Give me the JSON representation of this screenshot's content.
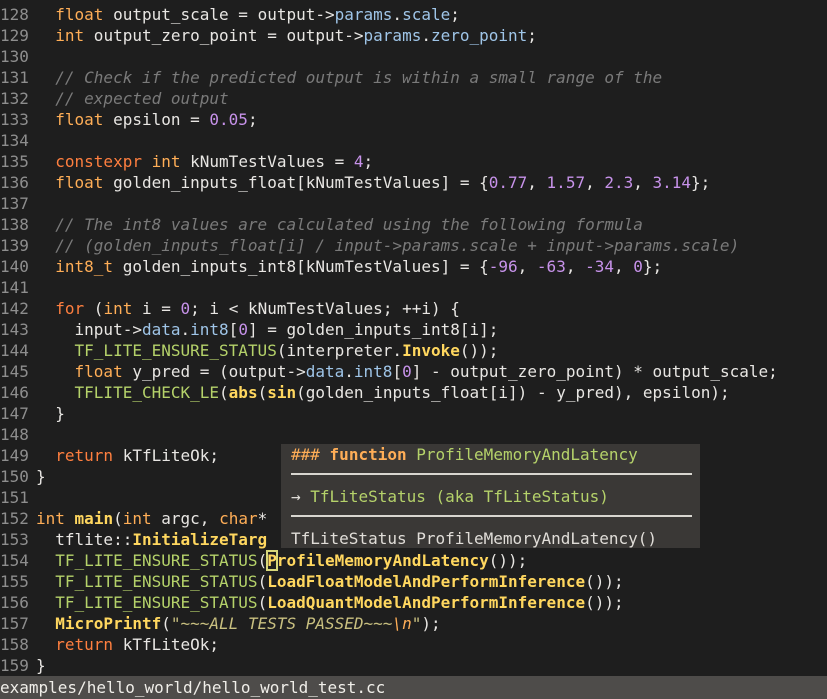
{
  "editor": {
    "lines": [
      {
        "n": "128",
        "t": [
          [
            "plain",
            "  "
          ],
          [
            "ty",
            "float"
          ],
          [
            "plain",
            " output_scale = output->"
          ],
          [
            "mem",
            "params"
          ],
          [
            "plain",
            "."
          ],
          [
            "mem",
            "scale"
          ],
          [
            "plain",
            ";"
          ]
        ]
      },
      {
        "n": "129",
        "t": [
          [
            "plain",
            "  "
          ],
          [
            "ty",
            "int"
          ],
          [
            "plain",
            " output_zero_point = output->"
          ],
          [
            "mem",
            "params"
          ],
          [
            "plain",
            "."
          ],
          [
            "mem",
            "zero_point"
          ],
          [
            "plain",
            ";"
          ]
        ]
      },
      {
        "n": "130",
        "t": []
      },
      {
        "n": "131",
        "t": [
          [
            "plain",
            "  "
          ],
          [
            "cmt",
            "// Check if the predicted output is within a small range of the"
          ]
        ]
      },
      {
        "n": "132",
        "t": [
          [
            "plain",
            "  "
          ],
          [
            "cmt",
            "// expected output"
          ]
        ]
      },
      {
        "n": "133",
        "t": [
          [
            "plain",
            "  "
          ],
          [
            "ty",
            "float"
          ],
          [
            "plain",
            " epsilon = "
          ],
          [
            "num",
            "0.05"
          ],
          [
            "plain",
            ";"
          ]
        ]
      },
      {
        "n": "134",
        "t": []
      },
      {
        "n": "135",
        "t": [
          [
            "plain",
            "  "
          ],
          [
            "kw",
            "constexpr"
          ],
          [
            "plain",
            " "
          ],
          [
            "ty",
            "int"
          ],
          [
            "plain",
            " kNumTestValues = "
          ],
          [
            "num",
            "4"
          ],
          [
            "plain",
            ";"
          ]
        ]
      },
      {
        "n": "136",
        "t": [
          [
            "plain",
            "  "
          ],
          [
            "ty",
            "float"
          ],
          [
            "plain",
            " golden_inputs_float[kNumTestValues] = {"
          ],
          [
            "num",
            "0.77"
          ],
          [
            "plain",
            ", "
          ],
          [
            "num",
            "1.57"
          ],
          [
            "plain",
            ", "
          ],
          [
            "num",
            "2.3"
          ],
          [
            "plain",
            ", "
          ],
          [
            "num",
            "3.14"
          ],
          [
            "plain",
            "};"
          ]
        ]
      },
      {
        "n": "137",
        "t": []
      },
      {
        "n": "138",
        "t": [
          [
            "plain",
            "  "
          ],
          [
            "cmt",
            "// The int8 values are calculated using the following formula"
          ]
        ]
      },
      {
        "n": "139",
        "t": [
          [
            "plain",
            "  "
          ],
          [
            "cmt",
            "// (golden_inputs_float[i] / input->params.scale + input->params.scale)"
          ]
        ]
      },
      {
        "n": "140",
        "t": [
          [
            "plain",
            "  "
          ],
          [
            "ty",
            "int8_t"
          ],
          [
            "plain",
            " golden_inputs_int8[kNumTestValues] = {"
          ],
          [
            "num",
            "-96"
          ],
          [
            "plain",
            ", "
          ],
          [
            "num",
            "-63"
          ],
          [
            "plain",
            ", "
          ],
          [
            "num",
            "-34"
          ],
          [
            "plain",
            ", "
          ],
          [
            "num",
            "0"
          ],
          [
            "plain",
            "};"
          ]
        ]
      },
      {
        "n": "141",
        "t": []
      },
      {
        "n": "142",
        "t": [
          [
            "plain",
            "  "
          ],
          [
            "kw",
            "for"
          ],
          [
            "plain",
            " ("
          ],
          [
            "ty",
            "int"
          ],
          [
            "plain",
            " i = "
          ],
          [
            "num",
            "0"
          ],
          [
            "plain",
            "; i < kNumTestValues; ++i) {"
          ]
        ]
      },
      {
        "n": "143",
        "t": [
          [
            "plain",
            "    input->"
          ],
          [
            "mem",
            "data"
          ],
          [
            "plain",
            "."
          ],
          [
            "mem",
            "int8"
          ],
          [
            "plain",
            "["
          ],
          [
            "num",
            "0"
          ],
          [
            "plain",
            "] = golden_inputs_int8[i];"
          ]
        ]
      },
      {
        "n": "144",
        "t": [
          [
            "plain",
            "    "
          ],
          [
            "mac",
            "TF_LITE_ENSURE_STATUS"
          ],
          [
            "plain",
            "(interpreter."
          ],
          [
            "fn",
            "Invoke"
          ],
          [
            "plain",
            "());"
          ]
        ]
      },
      {
        "n": "145",
        "t": [
          [
            "plain",
            "    "
          ],
          [
            "ty",
            "float"
          ],
          [
            "plain",
            " y_pred = (output->"
          ],
          [
            "mem",
            "data"
          ],
          [
            "plain",
            "."
          ],
          [
            "mem",
            "int8"
          ],
          [
            "plain",
            "["
          ],
          [
            "num",
            "0"
          ],
          [
            "plain",
            "] - output_zero_point) * output_scale;"
          ]
        ]
      },
      {
        "n": "146",
        "t": [
          [
            "plain",
            "    "
          ],
          [
            "mac",
            "TFLITE_CHECK_LE"
          ],
          [
            "plain",
            "("
          ],
          [
            "fn",
            "abs"
          ],
          [
            "plain",
            "("
          ],
          [
            "fn",
            "sin"
          ],
          [
            "plain",
            "(golden_inputs_float[i]) - y_pred), epsilon);"
          ]
        ]
      },
      {
        "n": "147",
        "t": [
          [
            "plain",
            "  }"
          ]
        ]
      },
      {
        "n": "148",
        "t": []
      },
      {
        "n": "149",
        "t": [
          [
            "plain",
            "  "
          ],
          [
            "kw",
            "return"
          ],
          [
            "plain",
            " kTfLiteOk;"
          ]
        ]
      },
      {
        "n": "150",
        "t": [
          [
            "plain",
            "}"
          ]
        ]
      },
      {
        "n": "151",
        "t": []
      },
      {
        "n": "152",
        "t": [
          [
            "ty",
            "int"
          ],
          [
            "plain",
            " "
          ],
          [
            "fn",
            "main"
          ],
          [
            "plain",
            "("
          ],
          [
            "ty",
            "int"
          ],
          [
            "plain",
            " argc, "
          ],
          [
            "ty",
            "char"
          ],
          [
            "plain",
            "*"
          ]
        ]
      },
      {
        "n": "153",
        "t": [
          [
            "plain",
            "  tflite::"
          ],
          [
            "fn",
            "InitializeTarg"
          ]
        ]
      },
      {
        "n": "154",
        "t": [
          [
            "plain",
            "  "
          ],
          [
            "mac",
            "TF_LITE_ENSURE_STATUS"
          ],
          [
            "plain",
            "("
          ],
          [
            "cur",
            "P"
          ],
          [
            "fn",
            "rofileMemoryAndLatency"
          ],
          [
            "plain",
            "());"
          ]
        ]
      },
      {
        "n": "155",
        "t": [
          [
            "plain",
            "  "
          ],
          [
            "mac",
            "TF_LITE_ENSURE_STATUS"
          ],
          [
            "plain",
            "("
          ],
          [
            "fn",
            "LoadFloatModelAndPerformInference"
          ],
          [
            "plain",
            "());"
          ]
        ]
      },
      {
        "n": "156",
        "t": [
          [
            "plain",
            "  "
          ],
          [
            "mac",
            "TF_LITE_ENSURE_STATUS"
          ],
          [
            "plain",
            "("
          ],
          [
            "fn",
            "LoadQuantModelAndPerformInference"
          ],
          [
            "plain",
            "());"
          ]
        ]
      },
      {
        "n": "157",
        "t": [
          [
            "plain",
            "  "
          ],
          [
            "fn",
            "MicroPrintf"
          ],
          [
            "plain",
            "("
          ],
          [
            "str",
            "\"~~~ALL TESTS PASSED~~~"
          ],
          [
            "esc",
            "\\n"
          ],
          [
            "str",
            "\""
          ],
          [
            "plain",
            ");"
          ]
        ]
      },
      {
        "n": "158",
        "t": [
          [
            "plain",
            "  "
          ],
          [
            "kw",
            "return"
          ],
          [
            "plain",
            " kTfLiteOk;"
          ]
        ]
      },
      {
        "n": "159",
        "t": [
          [
            "plain",
            "}"
          ]
        ]
      }
    ]
  },
  "hover": {
    "hash": "###",
    "kind": "function",
    "name": "ProfileMemoryAndLatency",
    "return_arrow": "→",
    "return_type": "TfLiteStatus (aka TfLiteStatus)",
    "signature": "TfLiteStatus ProfileMemoryAndLatency()"
  },
  "status_bar": {
    "file_path": "examples/hello_world/hello_world_test.cc"
  }
}
